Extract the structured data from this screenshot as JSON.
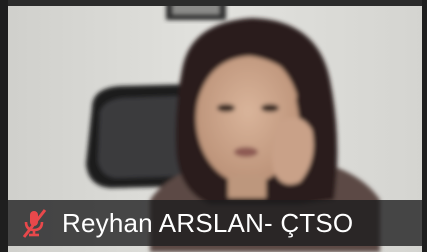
{
  "participant": {
    "name": "Reyhan ARSLAN- ÇTSO",
    "mic_status": "muted",
    "mic_icon": "muted-microphone-icon",
    "mic_color": "#e8484b"
  },
  "video": {
    "wall_color": "#d9d9d4",
    "hair_color": "#2a1f1a",
    "skin_color": "#cfa98f",
    "chair_color": "#1c1c1e"
  }
}
